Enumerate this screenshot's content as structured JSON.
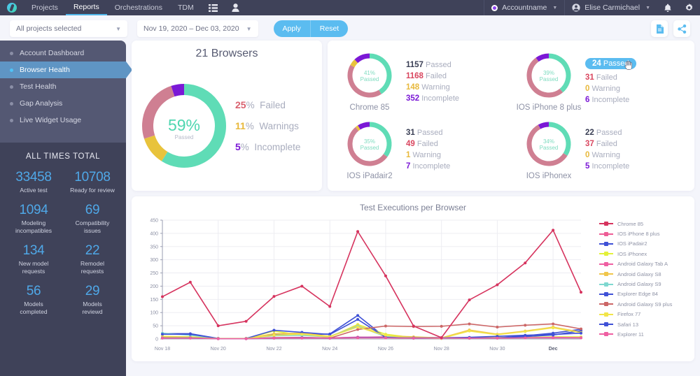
{
  "topnav": {
    "logo": "app-logo",
    "items": [
      {
        "label": "Projects",
        "active": false
      },
      {
        "label": "Reports",
        "active": true
      },
      {
        "label": "Orchestrations",
        "active": false
      },
      {
        "label": "TDM",
        "active": false
      }
    ],
    "list_icon": "list-icon",
    "person_icon": "person-icon",
    "account": "Accountname",
    "user": "Elise Carmichael",
    "bell_icon": "bell-icon",
    "gear_icon": "gear-icon"
  },
  "filterbar": {
    "project_select": "All projects selected",
    "date_range": "Nov 19, 2020  –  Dec 03, 2020",
    "apply": "Apply",
    "reset": "Reset",
    "export_icon": "document-export-icon",
    "share_icon": "share-icon"
  },
  "sidebar": {
    "items": [
      {
        "label": "Account Dashboard",
        "active": false
      },
      {
        "label": "Browser Health",
        "active": true
      },
      {
        "label": "Test Health",
        "active": false
      },
      {
        "label": "Gap Analysis",
        "active": false
      },
      {
        "label": "Live Widget Usage",
        "active": false
      }
    ],
    "totals_title": "ALL TIMES TOTAL",
    "stats": [
      {
        "num": "33458",
        "label": "Active test"
      },
      {
        "num": "10708",
        "label": "Ready for review"
      },
      {
        "num": "1094",
        "label": "Modeling\nincompatibles"
      },
      {
        "num": "69",
        "label": "Compatibility\nissues"
      },
      {
        "num": "134",
        "label": "New model\nrequests"
      },
      {
        "num": "22",
        "label": "Remodel\nrequests"
      },
      {
        "num": "56",
        "label": "Models\ncompleted"
      },
      {
        "num": "29",
        "label": "Models\nreviewd"
      }
    ]
  },
  "summary": {
    "title": "21 Browsers",
    "center_value": "59%",
    "center_label": "Passed",
    "passed_pct": 59,
    "legend": [
      {
        "value": "25",
        "pct": "%",
        "label": "Failed",
        "color": "#d9616f"
      },
      {
        "value": "11",
        "pct": "%",
        "label": "Warnings",
        "color": "#e8b93c"
      },
      {
        "value": "5",
        "pct": "%",
        "label": "Incomplete",
        "color": "#7b18d6"
      }
    ],
    "slices": [
      {
        "name": "Passed",
        "value": 59,
        "color": "#5fdcb6"
      },
      {
        "name": "Warnings",
        "value": 11,
        "color": "#e8c33c"
      },
      {
        "name": "Failed",
        "value": 25,
        "color": "#cf7f92"
      },
      {
        "name": "Incomplete",
        "value": 5,
        "color": "#7b18d6"
      }
    ]
  },
  "browsers": [
    {
      "name": "Chrome 85",
      "ring_label": "41%",
      "ring_sub": "Passed",
      "slices": [
        {
          "name": "Passed",
          "value": 41,
          "color": "#5fdcb6"
        },
        {
          "name": "Failed",
          "value": 42,
          "color": "#cf7f92"
        },
        {
          "name": "Warning",
          "value": 5,
          "color": "#e8c33c"
        },
        {
          "name": "Incomplete",
          "value": 12,
          "color": "#7b18d6"
        }
      ],
      "stats": [
        {
          "value": "1157",
          "label": "Passed",
          "kind": "pass",
          "highlighted": false
        },
        {
          "value": "1168",
          "label": "Failed",
          "kind": "fail",
          "highlighted": false
        },
        {
          "value": "148",
          "label": "Warning",
          "kind": "warn",
          "highlighted": false
        },
        {
          "value": "352",
          "label": "Incomplete",
          "kind": "inc",
          "highlighted": false
        }
      ]
    },
    {
      "name": "IOS iPhone 8 plus",
      "ring_label": "39%",
      "ring_sub": "Passed",
      "slices": [
        {
          "name": "Passed",
          "value": 39,
          "color": "#5fdcb6"
        },
        {
          "name": "Failed",
          "value": 51,
          "color": "#cf7f92"
        },
        {
          "name": "Warning",
          "value": 0,
          "color": "#e8c33c"
        },
        {
          "name": "Incomplete",
          "value": 10,
          "color": "#7b18d6"
        }
      ],
      "stats": [
        {
          "value": "24",
          "label": "Passed",
          "kind": "pass",
          "highlighted": true
        },
        {
          "value": "31",
          "label": "Failed",
          "kind": "fail",
          "highlighted": false
        },
        {
          "value": "0",
          "label": "Warning",
          "kind": "warn",
          "highlighted": false
        },
        {
          "value": "6",
          "label": "Incomplete",
          "kind": "inc",
          "highlighted": false
        }
      ]
    },
    {
      "name": "IOS iPadair2",
      "ring_label": "35%",
      "ring_sub": "Passed",
      "slices": [
        {
          "name": "Passed",
          "value": 35,
          "color": "#5fdcb6"
        },
        {
          "name": "Failed",
          "value": 54,
          "color": "#cf7f92"
        },
        {
          "name": "Warning",
          "value": 2,
          "color": "#e8c33c"
        },
        {
          "name": "Incomplete",
          "value": 9,
          "color": "#7b18d6"
        }
      ],
      "stats": [
        {
          "value": "31",
          "label": "Passed",
          "kind": "pass",
          "highlighted": false
        },
        {
          "value": "49",
          "label": "Failed",
          "kind": "fail",
          "highlighted": false
        },
        {
          "value": "1",
          "label": "Warning",
          "kind": "warn",
          "highlighted": false
        },
        {
          "value": "7",
          "label": "Incomplete",
          "kind": "inc",
          "highlighted": false
        }
      ]
    },
    {
      "name": "IOS iPhonex",
      "ring_label": "34%",
      "ring_sub": "Passed",
      "slices": [
        {
          "name": "Passed",
          "value": 34,
          "color": "#5fdcb6"
        },
        {
          "name": "Failed",
          "value": 58,
          "color": "#cf7f92"
        },
        {
          "name": "Warning",
          "value": 0,
          "color": "#e8c33c"
        },
        {
          "name": "Incomplete",
          "value": 8,
          "color": "#7b18d6"
        }
      ],
      "stats": [
        {
          "value": "22",
          "label": "Passed",
          "kind": "pass",
          "highlighted": false
        },
        {
          "value": "37",
          "label": "Failed",
          "kind": "fail",
          "highlighted": false
        },
        {
          "value": "0",
          "label": "Warning",
          "kind": "warn",
          "highlighted": false
        },
        {
          "value": "5",
          "label": "Incomplete",
          "kind": "inc",
          "highlighted": false
        }
      ]
    }
  ],
  "chart_data": {
    "type": "line",
    "title": "Test Executions per Browser",
    "xlabel": "",
    "ylabel": "",
    "ylim": [
      0,
      450
    ],
    "yticks": [
      0,
      50,
      100,
      150,
      200,
      250,
      300,
      350,
      400,
      450
    ],
    "grid": true,
    "legend_position": "right",
    "x": [
      "Nov 18",
      "Nov 19",
      "Nov 20",
      "Nov 21",
      "Nov 22",
      "Nov 23",
      "Nov 24",
      "Nov 25",
      "Nov 26",
      "Nov 27",
      "Nov 28",
      "Nov 29",
      "Nov 30",
      "Dec 1",
      "Dec 2",
      "Dec 3"
    ],
    "xticks": [
      "Nov 18",
      "",
      "Nov 20",
      "",
      "Nov 22",
      "",
      "Nov 24",
      "",
      "Nov 26",
      "",
      "Nov 28",
      "",
      "Nov 30",
      "",
      "Dec",
      ""
    ],
    "xtick_bold": [
      "Dec"
    ],
    "series": [
      {
        "name": "Chrome 85",
        "color": "#d6335e",
        "values": [
          160,
          215,
          50,
          67,
          161,
          200,
          123,
          407,
          239,
          49,
          5,
          148,
          205,
          288,
          412,
          177
        ]
      },
      {
        "name": "IOS iPhone 8 plus",
        "color": "#ee5d96",
        "values": [
          6,
          5,
          2,
          2,
          5,
          6,
          4,
          6,
          8,
          6,
          5,
          5,
          5,
          6,
          6,
          6
        ]
      },
      {
        "name": "IOS iPadair2",
        "color": "#3f51d6",
        "values": [
          20,
          20,
          2,
          2,
          16,
          16,
          19,
          89,
          5,
          3,
          3,
          3,
          4,
          12,
          22,
          37
        ]
      },
      {
        "name": "IOS iPhonex",
        "color": "#e3f03a",
        "values": [
          10,
          8,
          2,
          2,
          30,
          14,
          7,
          55,
          18,
          5,
          2,
          3,
          5,
          6,
          8,
          8
        ]
      },
      {
        "name": "Android Galaxy Tab A",
        "color": "#ef5fa2",
        "values": [
          5,
          4,
          1,
          1,
          4,
          5,
          4,
          7,
          5,
          4,
          3,
          3,
          4,
          5,
          6,
          5
        ]
      },
      {
        "name": "Android Galaxy S8",
        "color": "#f0c64b",
        "values": [
          9,
          7,
          2,
          2,
          20,
          22,
          10,
          50,
          12,
          8,
          4,
          34,
          18,
          30,
          45,
          26
        ]
      },
      {
        "name": "Android Galaxy S9",
        "color": "#7fd8d0",
        "values": [
          22,
          14,
          2,
          2,
          12,
          14,
          9,
          48,
          9,
          3,
          2,
          3,
          3,
          4,
          4,
          4
        ]
      },
      {
        "name": "Explorer Edge 84",
        "color": "#3f51d6",
        "values": [
          18,
          18,
          2,
          2,
          33,
          25,
          17,
          74,
          6,
          3,
          3,
          3,
          4,
          9,
          15,
          31
        ]
      },
      {
        "name": "Android Galaxy S9 plus",
        "color": "#cc6666",
        "values": [
          4,
          4,
          1,
          1,
          4,
          4,
          3,
          36,
          49,
          47,
          48,
          57,
          45,
          52,
          57,
          38
        ]
      },
      {
        "name": "Firefox 77",
        "color": "#f2e54a",
        "values": [
          8,
          6,
          2,
          2,
          14,
          18,
          9,
          45,
          13,
          4,
          2,
          30,
          16,
          28,
          42,
          24
        ]
      },
      {
        "name": "Safari 13",
        "color": "#3f51d6",
        "values": [
          4,
          4,
          1,
          1,
          3,
          4,
          3,
          5,
          5,
          4,
          4,
          6,
          10,
          14,
          17,
          22
        ]
      },
      {
        "name": "Explorer 11",
        "color": "#ef5fa2",
        "values": [
          3,
          3,
          1,
          1,
          3,
          3,
          3,
          4,
          4,
          3,
          3,
          3,
          3,
          4,
          4,
          4
        ]
      }
    ]
  }
}
